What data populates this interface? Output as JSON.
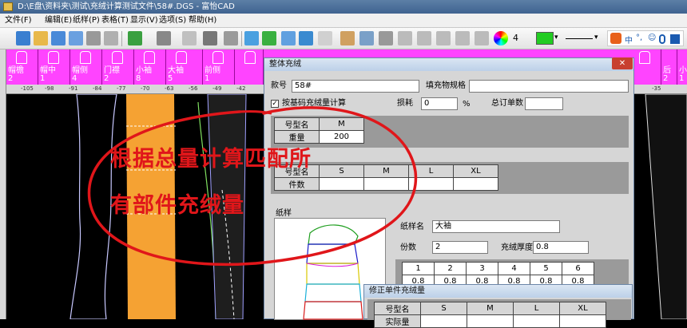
{
  "window": {
    "title": "D:\\E盘\\资料夹\\测试\\充绒计算测试文件\\58#.DGS - 富怡CAD"
  },
  "menu": {
    "items": [
      "文件(F)",
      "编辑(E)",
      "纸样(P)",
      "表格(T)",
      "显示(V)",
      "选项(S)",
      "帮助(H)"
    ]
  },
  "toolbar": {
    "width_value": "4",
    "ime_labels": [
      "中",
      "°,",
      "☺"
    ]
  },
  "pieces": [
    {
      "name": "帽檐",
      "count": "2"
    },
    {
      "name": "帽中",
      "count": "1"
    },
    {
      "name": "帽侧",
      "count": "4"
    },
    {
      "name": "门襟",
      "count": "2"
    },
    {
      "name": "小袖",
      "count": "8"
    },
    {
      "name": "大袖",
      "count": "5"
    },
    {
      "name": "前侧",
      "count": "1"
    },
    {
      "name": "",
      "count": ""
    },
    {
      "name": "",
      "count": ""
    },
    {
      "name": "后",
      "count": "2"
    },
    {
      "name": "小",
      "count": "1"
    }
  ],
  "ruler": {
    "ticks": [
      "-105",
      "-98",
      "-91",
      "-84",
      "-77",
      "-70",
      "-63",
      "-56",
      "-49",
      "-42",
      "-35"
    ]
  },
  "dialog_main": {
    "title": "整体充绒",
    "style_no_label": "款号",
    "style_no_value": "58#",
    "filling_spec_label": "填充物规格",
    "filling_spec_value": "",
    "calc_by_size_label": "按基码充绒量计算",
    "loss_label": "损耗",
    "loss_value": "0",
    "loss_unit": "%",
    "total_order_label": "总订单数",
    "total_order_value": "",
    "size_table": {
      "header": [
        "号型名",
        "M"
      ],
      "row": [
        "重量",
        "200"
      ]
    },
    "count_table": {
      "header": [
        "号型名",
        "S",
        "M",
        "L",
        "XL"
      ],
      "row": [
        "件数",
        "",
        "",
        "",
        ""
      ]
    },
    "pattern_group_label": "纸样",
    "pattern_name_label": "纸样名",
    "pattern_name_value": "大袖",
    "copies_label": "份数",
    "copies_value": "2",
    "thickness_label": "充绒厚度",
    "thickness_value": "0.8",
    "block_table": {
      "header": [
        "1",
        "2",
        "3",
        "4",
        "5",
        "6"
      ],
      "row": [
        "0.8",
        "0.8",
        "0.8",
        "0.8",
        "0.8",
        "0.8"
      ]
    }
  },
  "dialog_single": {
    "title": "修正单件充绒量",
    "header": [
      "号型名",
      "S",
      "M",
      "L",
      "XL"
    ],
    "row_label": "实际量"
  },
  "annotation": {
    "line1": "根据总量计算匹配所",
    "line2": "有部件充绒量",
    "color": "#e0161a"
  },
  "colors": {
    "piece_strip": "#ff44ff",
    "canvas": "#000000",
    "accent_orange": "#f5a233"
  }
}
